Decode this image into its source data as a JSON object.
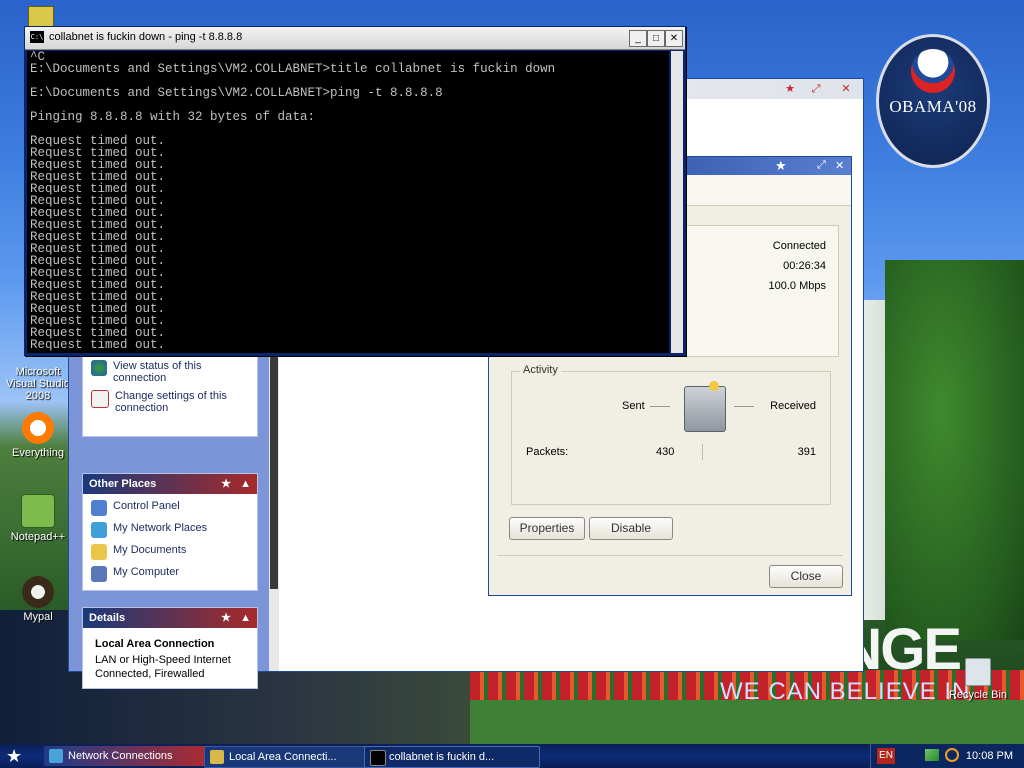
{
  "cmd": {
    "title": "collabnet is fuckin down - ping -t 8.8.8.8",
    "icon_text": "C:\\",
    "controls": {
      "minimize": "_",
      "maximize": "□",
      "close": "✕"
    },
    "output": "^C\nE:\\Documents and Settings\\VM2.COLLABNET>title collabnet is fuckin down\n\nE:\\Documents and Settings\\VM2.COLLABNET>ping -t 8.8.8.8\n\nPinging 8.8.8.8 with 32 bytes of data:\n\nRequest timed out.\nRequest timed out.\nRequest timed out.\nRequest timed out.\nRequest timed out.\nRequest timed out.\nRequest timed out.\nRequest timed out.\nRequest timed out.\nRequest timed out.\nRequest timed out.\nRequest timed out.\nRequest timed out.\nRequest timed out.\nRequest timed out.\nRequest timed out.\nRequest timed out.\nRequest timed out."
  },
  "status_dialog": {
    "status": "Connected",
    "duration": "00:26:34",
    "speed": "100.0 Mbps",
    "activity_label": "Activity",
    "sent_label": "Sent",
    "received_label": "Received",
    "packets_label": "Packets:",
    "packets_sent": "430",
    "packets_received": "391",
    "properties_button": "Properties",
    "disable_button": "Disable",
    "close_button": "Close"
  },
  "network_window": {
    "tasks": [
      {
        "label": "View status of this connection",
        "icon": "status-icon"
      },
      {
        "label": "Change settings of this connection",
        "icon": "settings-icon"
      }
    ],
    "other_places_title": "Other Places",
    "other_places": [
      {
        "label": "Control Panel",
        "icon": "control-panel-icon"
      },
      {
        "label": "My Network Places",
        "icon": "network-places-icon"
      },
      {
        "label": "My Documents",
        "icon": "documents-icon"
      },
      {
        "label": "My Computer",
        "icon": "computer-icon"
      }
    ],
    "details_title": "Details",
    "details_name": "Local Area Connection",
    "details_type": "LAN or High-Speed Internet",
    "details_status": "Connected, Firewalled"
  },
  "desktop_icons": [
    {
      "label": "Microsoft Visual Studio 2008",
      "icon": "visual-studio-icon"
    },
    {
      "label": "Everything",
      "icon": "everything-icon"
    },
    {
      "label": "Notepad++",
      "icon": "notepadpp-icon"
    },
    {
      "label": "Mypal",
      "icon": "mypal-icon"
    },
    {
      "label": "Recycle Bin",
      "icon": "recycle-bin-icon"
    }
  ],
  "wallpaper": {
    "badge_text": "OBAMA'08",
    "slogan_big": "NGE",
    "slogan_small": "WE CAN BELIEVE IN"
  },
  "taskbar": {
    "items": [
      {
        "label": "Network Connections",
        "icon": "network-connections-icon"
      },
      {
        "label": "Local Area Connecti...",
        "icon": "lan-icon"
      },
      {
        "label": "collabnet is fuckin d...",
        "icon": "cmd-icon"
      }
    ],
    "language": "EN",
    "clock": "10:08 PM"
  },
  "colors": {
    "taskbar": "#0d2b7a",
    "console_bg": "#000000",
    "console_fg": "#c0c0c0",
    "accent_red": "#b52a2a"
  }
}
